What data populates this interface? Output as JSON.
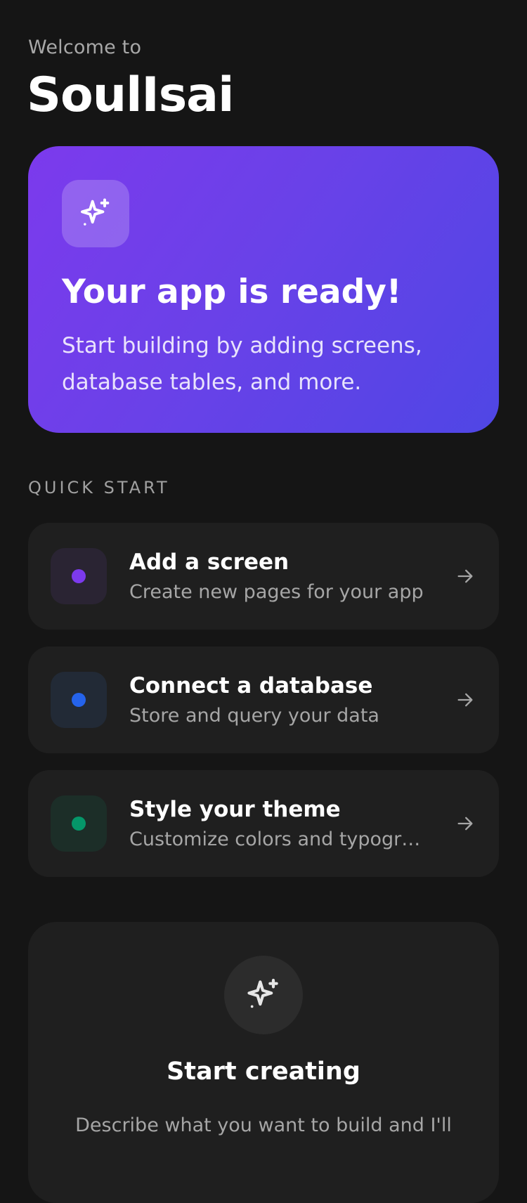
{
  "header": {
    "welcome": "Welcome to",
    "app_name": "SoulIsai"
  },
  "hero": {
    "icon": "sparkles-icon",
    "title": "Your app is ready!",
    "description": "Start building by adding screens, database tables, and more."
  },
  "quick_start": {
    "label": "QUICK START",
    "items": [
      {
        "title": "Add a screen",
        "subtitle": "Create new pages for your app",
        "dot_color": "#7c3aed",
        "icon_bg": "#2a2433",
        "icon": "arrow-right-icon"
      },
      {
        "title": "Connect a database",
        "subtitle": "Store and query your data",
        "dot_color": "#2563eb",
        "icon_bg": "#222a36",
        "icon": "arrow-right-icon"
      },
      {
        "title": "Style your theme",
        "subtitle": "Customize colors and typography",
        "dot_color": "#059669",
        "icon_bg": "#1c2e28",
        "icon": "arrow-right-icon"
      }
    ]
  },
  "create": {
    "icon": "sparkles-icon",
    "title": "Start creating",
    "description": "Describe what you want to build and I'll"
  },
  "colors": {
    "background": "#151515",
    "card": "#1f1f1f",
    "accent_start": "#7c3aed",
    "accent_end": "#4f46e5"
  }
}
